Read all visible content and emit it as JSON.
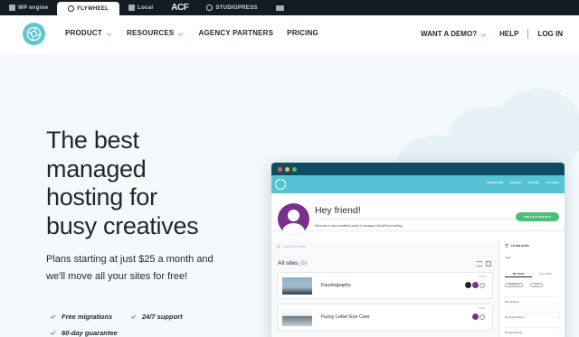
{
  "brandbar": {
    "items": [
      {
        "label": "WP engine",
        "icon": "wpengine-icon"
      },
      {
        "label": "FLYWHEEL",
        "icon": "flywheel-icon"
      },
      {
        "label": "Local",
        "icon": "local-icon"
      },
      {
        "label": "ACF",
        "icon": "acf-logo"
      },
      {
        "label": "STUDIOPRESS",
        "icon": "studiopress-icon"
      },
      {
        "label": "",
        "icon": "genesis-icon"
      }
    ]
  },
  "nav": {
    "links": [
      {
        "label": "PRODUCT",
        "dropdown": true
      },
      {
        "label": "RESOURCES",
        "dropdown": true
      },
      {
        "label": "AGENCY PARTNERS",
        "dropdown": false
      },
      {
        "label": "PRICING",
        "dropdown": false
      }
    ],
    "demo": "WANT A DEMO?",
    "help": "HELP",
    "login": "LOG IN",
    "accent": "#5ec6d3"
  },
  "hero": {
    "title_lines": [
      "The best",
      "managed",
      "hosting for",
      "busy creatives"
    ],
    "subtitle": "Plans starting at just $25 a month and we'll move all your sites for free!",
    "features": [
      "Free migrations",
      "24/7 support",
      "60-day guarantee"
    ],
    "check_color": "#4bbf7a"
  },
  "app": {
    "menu": [
      "DASHBOARD",
      "MANAGE",
      "PAY ONE",
      "GET HELP"
    ],
    "greeting": "Hey friend!",
    "welcome": "Welcome to the wonderful world of managed WordPress hosting",
    "create_button": "CREATE A NEW SITE",
    "search_placeholder": "Search your sites",
    "all_sites_label": "All sites",
    "all_sites_count": "(6)",
    "sites": [
      {
        "name": "Fauxtography",
        "meta": "2 TAG"
      },
      {
        "name": "Fuzzy Letter Eye Care",
        "meta": "1 TAG"
      }
    ],
    "sidebar": {
      "header": "FILTER SITES",
      "tags_label": "Tags",
      "tab_my": "MY TAGS",
      "tab_all": "ALL TAGS",
      "pills": [
        "Asking docs",
        "ecom"
      ],
      "rows": [
        "Site Settings",
        "My Organizations",
        "My Rank Points"
      ]
    }
  }
}
